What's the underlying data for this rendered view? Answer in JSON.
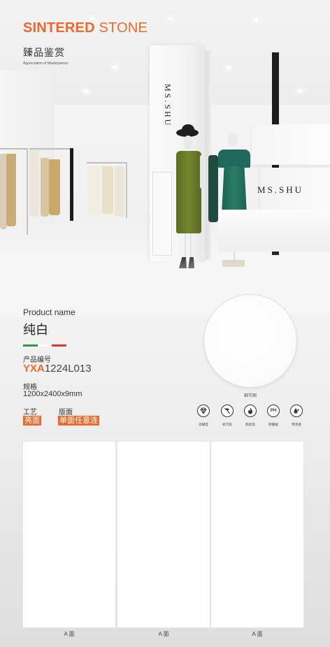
{
  "header": {
    "title_bold": "SINTERED",
    "title_light": "STONE",
    "subtitle_cn": "臻品鉴赏",
    "subtitle_en": "Appreciation of Masterpieces",
    "accent_color": "#ea6a2c"
  },
  "scene": {
    "brand_vertical": "MS.SHU",
    "brand_horizontal": "MS.SHU"
  },
  "product": {
    "name_label": "Product name",
    "name_value": "纯白",
    "flag_colors": [
      "#2e9a48",
      "#ffffff",
      "#d63a2e"
    ],
    "code_label": "产品编号",
    "code_prefix": "YXA",
    "code_number": "1224L013",
    "spec_label": "规格",
    "spec_value": "1200x2400x9mm",
    "process_label": "工艺",
    "process_value": "亮面",
    "surface_label": "版面",
    "surface_value": "单面任意连"
  },
  "detail": {
    "caption": "细节图"
  },
  "features": [
    {
      "icon": "diamond-icon",
      "label": "高硬度"
    },
    {
      "icon": "hammer-icon",
      "label": "抗污染"
    },
    {
      "icon": "flame-icon",
      "label": "耐高温"
    },
    {
      "icon": "ph-icon",
      "label": "耐酸碱",
      "text": "PH"
    },
    {
      "icon": "water-drop-icon",
      "label": "零渗透"
    }
  ],
  "slabs": [
    {
      "caption": "A 面"
    },
    {
      "caption": "A 面"
    },
    {
      "caption": "A 面"
    }
  ]
}
